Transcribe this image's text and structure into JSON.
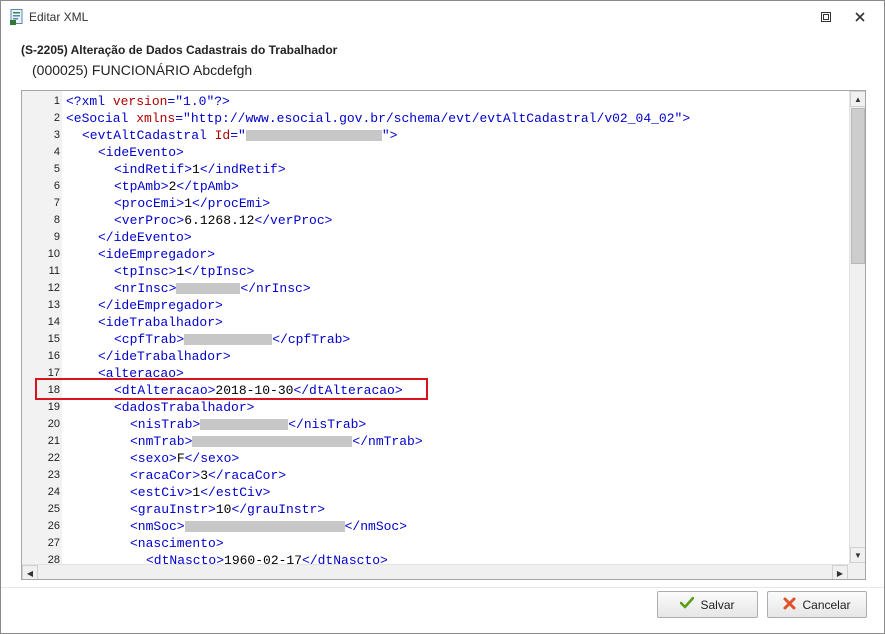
{
  "window": {
    "title": "Editar XML"
  },
  "header": {
    "title": "(S-2205) Alteração de Dados Cadastrais do Trabalhador",
    "subtitle": "(000025) FUNCIONÁRIO Abcdefgh"
  },
  "editor": {
    "highlighted_line": 18,
    "lines": [
      {
        "n": "1",
        "indent": 0,
        "parts": [
          [
            "tag",
            "<?xml "
          ],
          [
            "attr",
            "version"
          ],
          [
            "tag",
            "="
          ],
          [
            "val",
            "\"1.0\""
          ],
          [
            "tag",
            "?>"
          ]
        ]
      },
      {
        "n": "2",
        "indent": 0,
        "parts": [
          [
            "tag",
            "<eSocial "
          ],
          [
            "attr",
            "xmlns"
          ],
          [
            "tag",
            "="
          ],
          [
            "val",
            "\"http://www.esocial.gov.br/schema/evt/evtAltCadastral/v02_04_02\""
          ],
          [
            "tag",
            ">"
          ]
        ]
      },
      {
        "n": "3",
        "indent": 1,
        "parts": [
          [
            "tag",
            "<evtAltCadastral "
          ],
          [
            "attr",
            "Id"
          ],
          [
            "tag",
            "="
          ],
          [
            "val",
            "\""
          ],
          [
            "redact",
            136
          ],
          [
            "tag",
            "\">"
          ]
        ]
      },
      {
        "n": "4",
        "indent": 2,
        "parts": [
          [
            "tag",
            "<ideEvento>"
          ]
        ]
      },
      {
        "n": "5",
        "indent": 3,
        "parts": [
          [
            "tag",
            "<indRetif>"
          ],
          [
            "text",
            "1"
          ],
          [
            "tag",
            "</indRetif>"
          ]
        ]
      },
      {
        "n": "6",
        "indent": 3,
        "parts": [
          [
            "tag",
            "<tpAmb>"
          ],
          [
            "text",
            "2"
          ],
          [
            "tag",
            "</tpAmb>"
          ]
        ]
      },
      {
        "n": "7",
        "indent": 3,
        "parts": [
          [
            "tag",
            "<procEmi>"
          ],
          [
            "text",
            "1"
          ],
          [
            "tag",
            "</procEmi>"
          ]
        ]
      },
      {
        "n": "8",
        "indent": 3,
        "parts": [
          [
            "tag",
            "<verProc>"
          ],
          [
            "text",
            "6.1268.12"
          ],
          [
            "tag",
            "</verProc>"
          ]
        ]
      },
      {
        "n": "9",
        "indent": 2,
        "parts": [
          [
            "tag",
            "</ideEvento>"
          ]
        ]
      },
      {
        "n": "10",
        "indent": 2,
        "parts": [
          [
            "tag",
            "<ideEmpregador>"
          ]
        ]
      },
      {
        "n": "11",
        "indent": 3,
        "parts": [
          [
            "tag",
            "<tpInsc>"
          ],
          [
            "text",
            "1"
          ],
          [
            "tag",
            "</tpInsc>"
          ]
        ]
      },
      {
        "n": "12",
        "indent": 3,
        "parts": [
          [
            "tag",
            "<nrInsc>"
          ],
          [
            "redact",
            64
          ],
          [
            "tag",
            "</nrInsc>"
          ]
        ]
      },
      {
        "n": "13",
        "indent": 2,
        "parts": [
          [
            "tag",
            "</ideEmpregador>"
          ]
        ]
      },
      {
        "n": "14",
        "indent": 2,
        "parts": [
          [
            "tag",
            "<ideTrabalhador>"
          ]
        ]
      },
      {
        "n": "15",
        "indent": 3,
        "parts": [
          [
            "tag",
            "<cpfTrab>"
          ],
          [
            "redact",
            88
          ],
          [
            "tag",
            "</cpfTrab>"
          ]
        ]
      },
      {
        "n": "16",
        "indent": 2,
        "parts": [
          [
            "tag",
            "</ideTrabalhador>"
          ]
        ]
      },
      {
        "n": "17",
        "indent": 2,
        "parts": [
          [
            "tag",
            "<alteracao>"
          ]
        ]
      },
      {
        "n": "18",
        "indent": 3,
        "parts": [
          [
            "tag",
            "<dtAlteracao>"
          ],
          [
            "text",
            "2018-10-30"
          ],
          [
            "tag",
            "</dtAlteracao>"
          ]
        ]
      },
      {
        "n": "19",
        "indent": 3,
        "parts": [
          [
            "tag",
            "<dadosTrabalhador>"
          ]
        ]
      },
      {
        "n": "20",
        "indent": 4,
        "parts": [
          [
            "tag",
            "<nisTrab>"
          ],
          [
            "redact",
            88
          ],
          [
            "tag",
            "</nisTrab>"
          ]
        ]
      },
      {
        "n": "21",
        "indent": 4,
        "parts": [
          [
            "tag",
            "<nmTrab>"
          ],
          [
            "redact",
            160
          ],
          [
            "tag",
            "</nmTrab>"
          ]
        ]
      },
      {
        "n": "22",
        "indent": 4,
        "parts": [
          [
            "tag",
            "<sexo>"
          ],
          [
            "text",
            "F"
          ],
          [
            "tag",
            "</sexo>"
          ]
        ]
      },
      {
        "n": "23",
        "indent": 4,
        "parts": [
          [
            "tag",
            "<racaCor>"
          ],
          [
            "text",
            "3"
          ],
          [
            "tag",
            "</racaCor>"
          ]
        ]
      },
      {
        "n": "24",
        "indent": 4,
        "parts": [
          [
            "tag",
            "<estCiv>"
          ],
          [
            "text",
            "1"
          ],
          [
            "tag",
            "</estCiv>"
          ]
        ]
      },
      {
        "n": "25",
        "indent": 4,
        "parts": [
          [
            "tag",
            "<grauInstr>"
          ],
          [
            "text",
            "10"
          ],
          [
            "tag",
            "</grauInstr>"
          ]
        ]
      },
      {
        "n": "26",
        "indent": 4,
        "parts": [
          [
            "tag",
            "<nmSoc>"
          ],
          [
            "redact",
            160
          ],
          [
            "tag",
            "</nmSoc>"
          ]
        ]
      },
      {
        "n": "27",
        "indent": 4,
        "parts": [
          [
            "tag",
            "<nascimento>"
          ]
        ]
      },
      {
        "n": "28",
        "indent": 5,
        "parts": [
          [
            "tag",
            "<dtNascto>"
          ],
          [
            "text",
            "1960-02-17"
          ],
          [
            "tag",
            "</dtNascto>"
          ]
        ]
      }
    ]
  },
  "footer": {
    "save_label": "Salvar",
    "cancel_label": "Cancelar"
  },
  "icons": {
    "app": "xml-document-icon",
    "restore": "restore-window-icon",
    "close": "close-icon",
    "save": "check-icon",
    "cancel": "x-icon"
  },
  "colors": {
    "tag": "#0000cc",
    "attr": "#b00000",
    "highlight_border": "#d8151c",
    "save_check": "#5a9e1a",
    "cancel_x": "#e0522a"
  }
}
